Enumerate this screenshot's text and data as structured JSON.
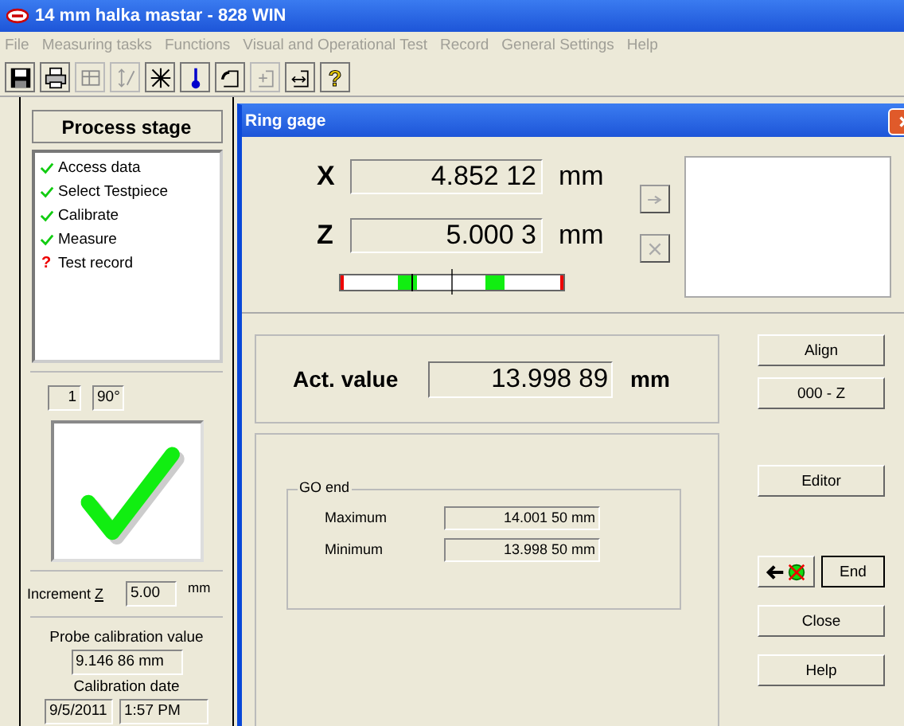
{
  "window": {
    "title": "14 mm halka mastar - 828 WIN"
  },
  "menu": [
    "File",
    "Measuring tasks",
    "Functions",
    "Visual and Operational Test",
    "Record",
    "General Settings",
    "Help"
  ],
  "toolbar": [
    {
      "kind": "save",
      "disabled": false
    },
    {
      "kind": "print",
      "disabled": false
    },
    {
      "kind": "table",
      "disabled": true
    },
    {
      "kind": "axis",
      "disabled": true
    },
    {
      "kind": "probe",
      "disabled": false
    },
    {
      "kind": "thermometer",
      "disabled": false
    },
    {
      "kind": "frame-left",
      "disabled": false
    },
    {
      "kind": "frame-plus",
      "disabled": true
    },
    {
      "kind": "frame-arrows",
      "disabled": false
    },
    {
      "kind": "help",
      "label": "?",
      "disabled": false
    }
  ],
  "process_stage": {
    "title": "Process stage",
    "steps": [
      {
        "label": "Access data",
        "done": true
      },
      {
        "label": "Select Testpiece",
        "done": true
      },
      {
        "label": "Calibrate",
        "done": true
      },
      {
        "label": "Measure",
        "done": true
      },
      {
        "label": "Test record",
        "done": false,
        "marker": "?"
      }
    ]
  },
  "position": {
    "count": "1",
    "angle": "90°"
  },
  "result_ok": true,
  "increment": {
    "label": "Increment ",
    "accelerator": "Z",
    "value": "5.00",
    "unit": "mm"
  },
  "probe_calibration": {
    "label": "Probe calibration value",
    "value": "9.146 86 mm"
  },
  "calibration_date": {
    "label": "Calibration date",
    "date": "9/5/2011",
    "time": "1:57 PM"
  },
  "dialog": {
    "title": "Ring gage",
    "axes": [
      {
        "axis": "X",
        "value": "4.852 12",
        "unit": "mm"
      },
      {
        "axis": "Z",
        "value": "5.000 3",
        "unit": "mm"
      }
    ],
    "side_buttons": [
      {
        "kind": "arrow",
        "disabled": true
      },
      {
        "kind": "clear",
        "disabled": true
      }
    ],
    "actual": {
      "label": "Act. value",
      "value": "13.998 89",
      "unit": "mm"
    },
    "go_end": {
      "title": "GO end",
      "rows": [
        {
          "label": "Maximum",
          "value": "14.001 50 mm"
        },
        {
          "label": "Minimum",
          "value": "13.998 50 mm"
        }
      ]
    },
    "buttons": {
      "align": "Align",
      "zero": "000 - Z",
      "editor": "Editor",
      "end": "End",
      "close": "Close",
      "help": "Help"
    }
  }
}
